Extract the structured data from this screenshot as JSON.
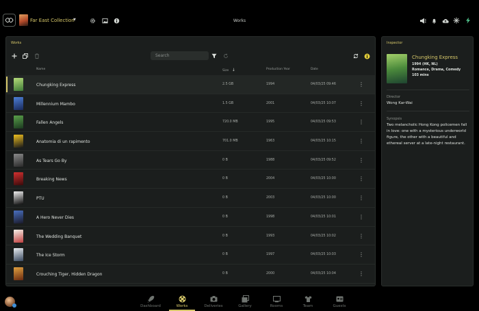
{
  "header": {
    "collection_name": "Far East Collection",
    "center_title": "Works"
  },
  "works_panel": {
    "label": "Works",
    "search_placeholder": "Search",
    "columns": {
      "name": "Name",
      "size": "Size",
      "year": "Production Year",
      "date": "Date"
    },
    "rows": [
      {
        "name": "Chungking Express",
        "size": "2.5 GB",
        "year": "1994",
        "date": "04/03/25 09:46",
        "selected": true,
        "poster": [
          "#b5dc7a",
          "#3f7a38"
        ]
      },
      {
        "name": "Millennium Mambo",
        "size": "1.5 GB",
        "year": "2001",
        "date": "04/03/25 10:07",
        "selected": false,
        "poster": [
          "#4d7fd6",
          "#1a2a5a"
        ]
      },
      {
        "name": "Fallen Angels",
        "size": "720.0 MB",
        "year": "1995",
        "date": "04/03/25 09:53",
        "selected": false,
        "poster": [
          "#5aa04a",
          "#1c3a20"
        ]
      },
      {
        "name": "Anatomia di un rapimento",
        "size": "701.0 MB",
        "year": "1963",
        "date": "04/03/25 10:15",
        "selected": false,
        "poster": [
          "#f0c020",
          "#1a1a1a"
        ]
      },
      {
        "name": "As Tears Go By",
        "size": "0 B",
        "year": "1988",
        "date": "04/03/25 09:52",
        "selected": false,
        "poster": [
          "#8a8a8a",
          "#2a2a2a"
        ]
      },
      {
        "name": "Breaking News",
        "size": "0 B",
        "year": "2004",
        "date": "04/03/25 10:00",
        "selected": false,
        "poster": [
          "#d03030",
          "#3a0a0a"
        ]
      },
      {
        "name": "PTU",
        "size": "0 B",
        "year": "2003",
        "date": "04/03/25 10:00",
        "selected": false,
        "poster": [
          "#f0f0f0",
          "#101010"
        ]
      },
      {
        "name": "A Hero Never Dies",
        "size": "0 B",
        "year": "1998",
        "date": "04/03/25 10:01",
        "selected": false,
        "poster": [
          "#4a70c0",
          "#1a1a2a"
        ]
      },
      {
        "name": "The Wedding Banquet",
        "size": "0 B",
        "year": "1993",
        "date": "04/03/25 10:02",
        "selected": false,
        "poster": [
          "#f4f0e8",
          "#c04040"
        ]
      },
      {
        "name": "The Ice Storm",
        "size": "0 B",
        "year": "1997",
        "date": "04/03/25 10:03",
        "selected": false,
        "poster": [
          "#e8ecf0",
          "#3a4a60"
        ]
      },
      {
        "name": "Crouching Tiger, Hidden Dragon",
        "size": "0 B",
        "year": "2000",
        "date": "04/03/25 10:04",
        "selected": false,
        "poster": [
          "#e0a040",
          "#6a2a10"
        ]
      }
    ]
  },
  "inspector": {
    "label": "Inspector",
    "title": "Chungking Express",
    "meta_line1": "1994 (HK, NL)",
    "meta_line2": "Romance, Drama, Comedy",
    "meta_line3": "103 mins",
    "director_label": "Director",
    "director": "Wong Kar-Wai",
    "synopsis_label": "Synopsis",
    "synopsis": "Two melancholic Hong Kong policemen fall in love: one with a mysterious underworld figure, the other with a beautiful and ethereal server at a late-night restaurant."
  },
  "bottom_nav": {
    "items": [
      {
        "label": "Dashboard",
        "icon": "rocket-icon",
        "active": false
      },
      {
        "label": "Works",
        "icon": "film-reel-icon",
        "active": true
      },
      {
        "label": "Deliveries",
        "icon": "camera-icon",
        "active": false
      },
      {
        "label": "Gallery",
        "icon": "gallery-icon",
        "active": false
      },
      {
        "label": "Rooms",
        "icon": "screen-icon",
        "active": false
      },
      {
        "label": "Team",
        "icon": "shirt-icon",
        "active": false
      },
      {
        "label": "Guests",
        "icon": "id-card-icon",
        "active": false
      }
    ]
  },
  "colors": {
    "accent": "#d7c86a",
    "panel": "#1b1e1d",
    "background": "#000000"
  }
}
